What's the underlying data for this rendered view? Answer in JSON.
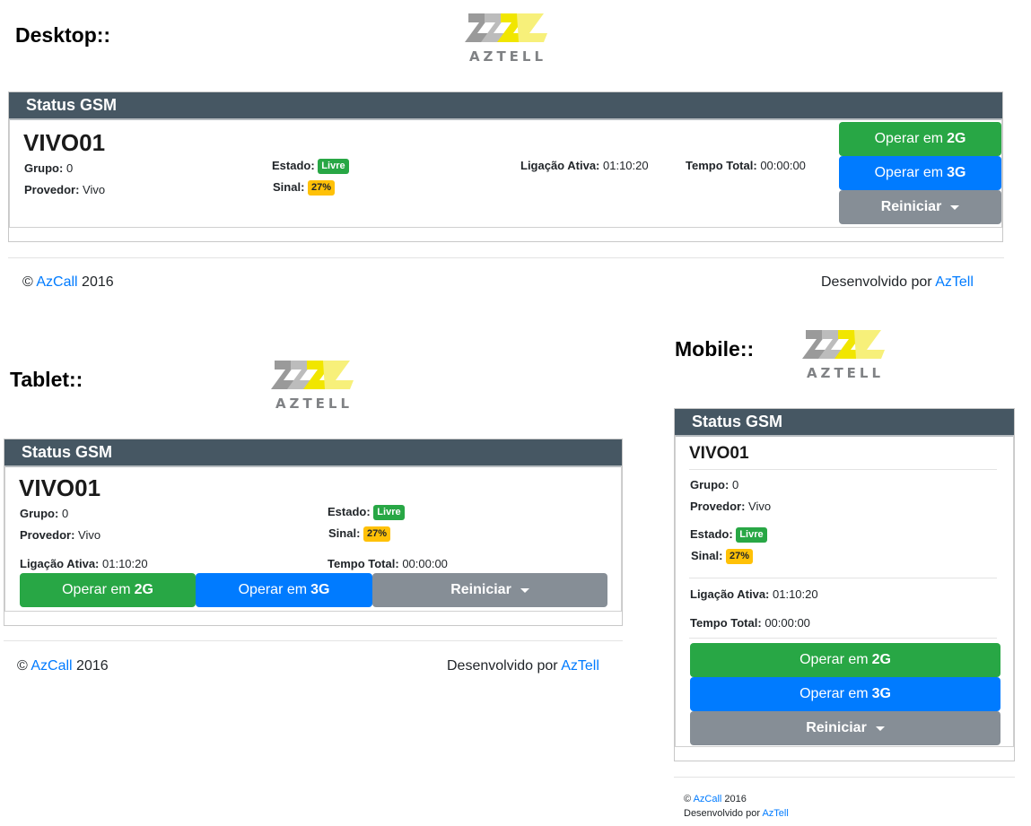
{
  "labels": {
    "desktop": "Desktop::",
    "tablet": "Tablet::",
    "mobile": "Mobile::"
  },
  "logo": {
    "text": "AZTELL"
  },
  "panel": {
    "title": "Status GSM",
    "device": "VIVO01",
    "grupo_label": "Grupo:",
    "grupo_value": "0",
    "provedor_label": "Provedor:",
    "provedor_value": "Vivo",
    "estado_label": "Estado:",
    "estado_value": "Livre",
    "sinal_label": "Sinal:",
    "sinal_value": "27%",
    "ligacao_label": "Ligação Ativa:",
    "ligacao_value": "01:10:20",
    "tempo_label": "Tempo Total:",
    "tempo_value": "00:00:00"
  },
  "buttons": {
    "op_prefix": "Operar em",
    "op_2g": "2G",
    "op_3g": "3G",
    "reiniciar": "Reiniciar"
  },
  "footer": {
    "copyright": "©",
    "company": "AzCall",
    "year": "2016",
    "dev_text": "Desenvolvido por",
    "dev_link": "AzTell"
  },
  "colors": {
    "header": "#465763",
    "green": "#28a745",
    "blue": "#007bff",
    "gray": "#868e96",
    "yellow": "#ffc107",
    "link": "#007bff"
  }
}
